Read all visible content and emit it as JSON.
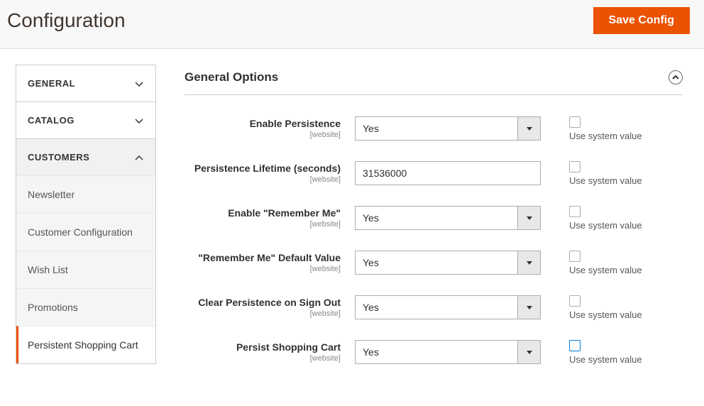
{
  "header": {
    "title": "Configuration",
    "save_button": "Save Config"
  },
  "sidebar": {
    "sections": [
      {
        "label": "GENERAL",
        "expanded": false
      },
      {
        "label": "CATALOG",
        "expanded": false
      },
      {
        "label": "CUSTOMERS",
        "expanded": true
      }
    ],
    "customers_items": [
      {
        "label": "Newsletter",
        "active": false
      },
      {
        "label": "Customer Configuration",
        "active": false
      },
      {
        "label": "Wish List",
        "active": false
      },
      {
        "label": "Promotions",
        "active": false
      },
      {
        "label": "Persistent Shopping Cart",
        "active": true
      }
    ]
  },
  "section": {
    "title": "General Options"
  },
  "scope_label": "[website]",
  "system_label": "Use system value",
  "fields": {
    "enable_persistence": {
      "label": "Enable Persistence",
      "value": "Yes"
    },
    "lifetime": {
      "label": "Persistence Lifetime (seconds)",
      "value": "31536000"
    },
    "remember_me": {
      "label": "Enable \"Remember Me\"",
      "value": "Yes"
    },
    "remember_default": {
      "label": "\"Remember Me\" Default Value",
      "value": "Yes"
    },
    "clear_signout": {
      "label": "Clear Persistence on Sign Out",
      "value": "Yes"
    },
    "persist_cart": {
      "label": "Persist Shopping Cart",
      "value": "Yes"
    }
  }
}
